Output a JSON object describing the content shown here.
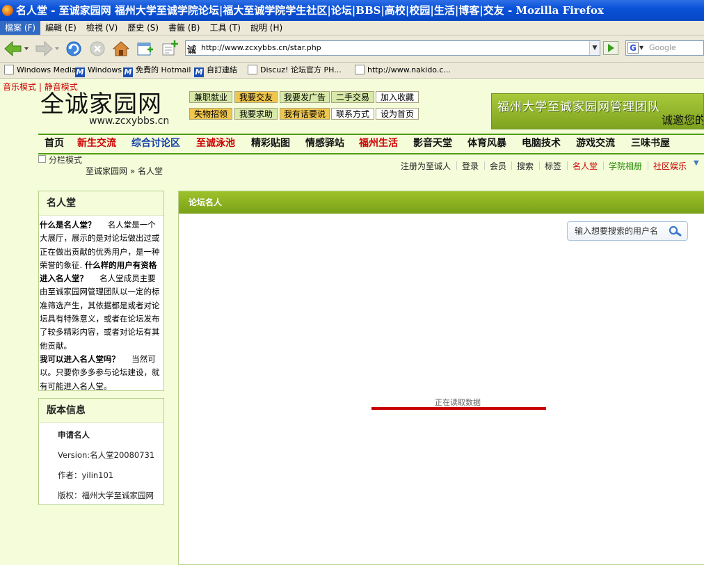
{
  "window": {
    "title": "名人堂 - 至诚家园网 福州大学至诚学院论坛|福大至诚学院学生社区|论坛|BBS|高校|校园|生活|博客|交友 - Mozilla Firefox"
  },
  "menubar": {
    "items": [
      "檔案 (F)",
      "編輯 (E)",
      "檢視 (V)",
      "歷史 (S)",
      "書籤 (B)",
      "工具 (T)",
      "說明 (H)"
    ]
  },
  "navbar": {
    "site_icon_char": "诚",
    "url": "http://www.zcxybbs.cn/star.php",
    "search_engine_glyph": "G",
    "search_placeholder": "Google"
  },
  "bookmarks": {
    "items": [
      "Windows Media",
      "Windows",
      "免費的 Hotmail",
      "自訂連結",
      "Discuz! 论坛官方 PH...",
      "http://www.nakido.c..."
    ]
  },
  "page": {
    "music_mode": "音乐模式",
    "quiet_mode": "静音模式",
    "logo_text": "全诚家园网",
    "logo_url": "www.zcxybbs.cn",
    "top_buttons": [
      [
        "兼职就业",
        "我要交友",
        "我要发广告",
        "二手交易",
        "加入收藏"
      ],
      [
        "失物招领",
        "我要求助",
        "我有话要说",
        "联系方式",
        "设为首页"
      ]
    ],
    "banner_line1": "福州大学至诚家园网管理团队",
    "banner_line2": "诚邀您的",
    "main_nav": [
      "首页",
      "新生交流",
      "综合讨论区",
      "至诚泳池",
      "精彩贴图",
      "情感驿站",
      "福州生活",
      "影音天堂",
      "体育风暴",
      "电脑技术",
      "游戏交流",
      "三味书屋"
    ],
    "split_mode": "分栏模式",
    "breadcrumb": "至诚家园网 » 名人堂",
    "user_links": [
      "注册为至诚人",
      "登录",
      "会员",
      "搜索",
      "标签",
      "名人堂",
      "学院相册",
      "社区娱乐"
    ],
    "colors": {
      "accent_green": "#4d9e10",
      "nav_red": "#cc0000",
      "nav_blue": "#1540a8",
      "link_green": "#228800"
    }
  },
  "sidebar": {
    "intro_title": "名人堂",
    "intro_paragraphs": [
      {
        "q": "什么是名人堂？",
        "a": "名人堂是一个大展厅，展示的是对论坛做出过或正在做出贡献的优秀用户，是一种荣誉的象征."
      },
      {
        "q": "什么样的用户有资格进入名人堂？",
        "a": "名人堂成员主要由至诚家园网管理团队以一定的标准筛选产生，其依据都是或者对论坛具有特殊意义，或者在论坛发布了较多精彩内容，或者对论坛有其他贡献。"
      },
      {
        "q": "我可以进入名人堂吗？",
        "a": "当然可以。只要你多多参与论坛建设，就有可能进入名人堂。"
      }
    ],
    "version_title": "版本信息",
    "apply": "申请名人",
    "version": "Version:名人堂20080731",
    "author": "作者：yilin101",
    "copyright": "版权：福州大学至诚家园网"
  },
  "main": {
    "section_title": "论坛名人",
    "search_placeholder": "输入想要搜索的用户名",
    "loading_text": "正在读取数据"
  }
}
